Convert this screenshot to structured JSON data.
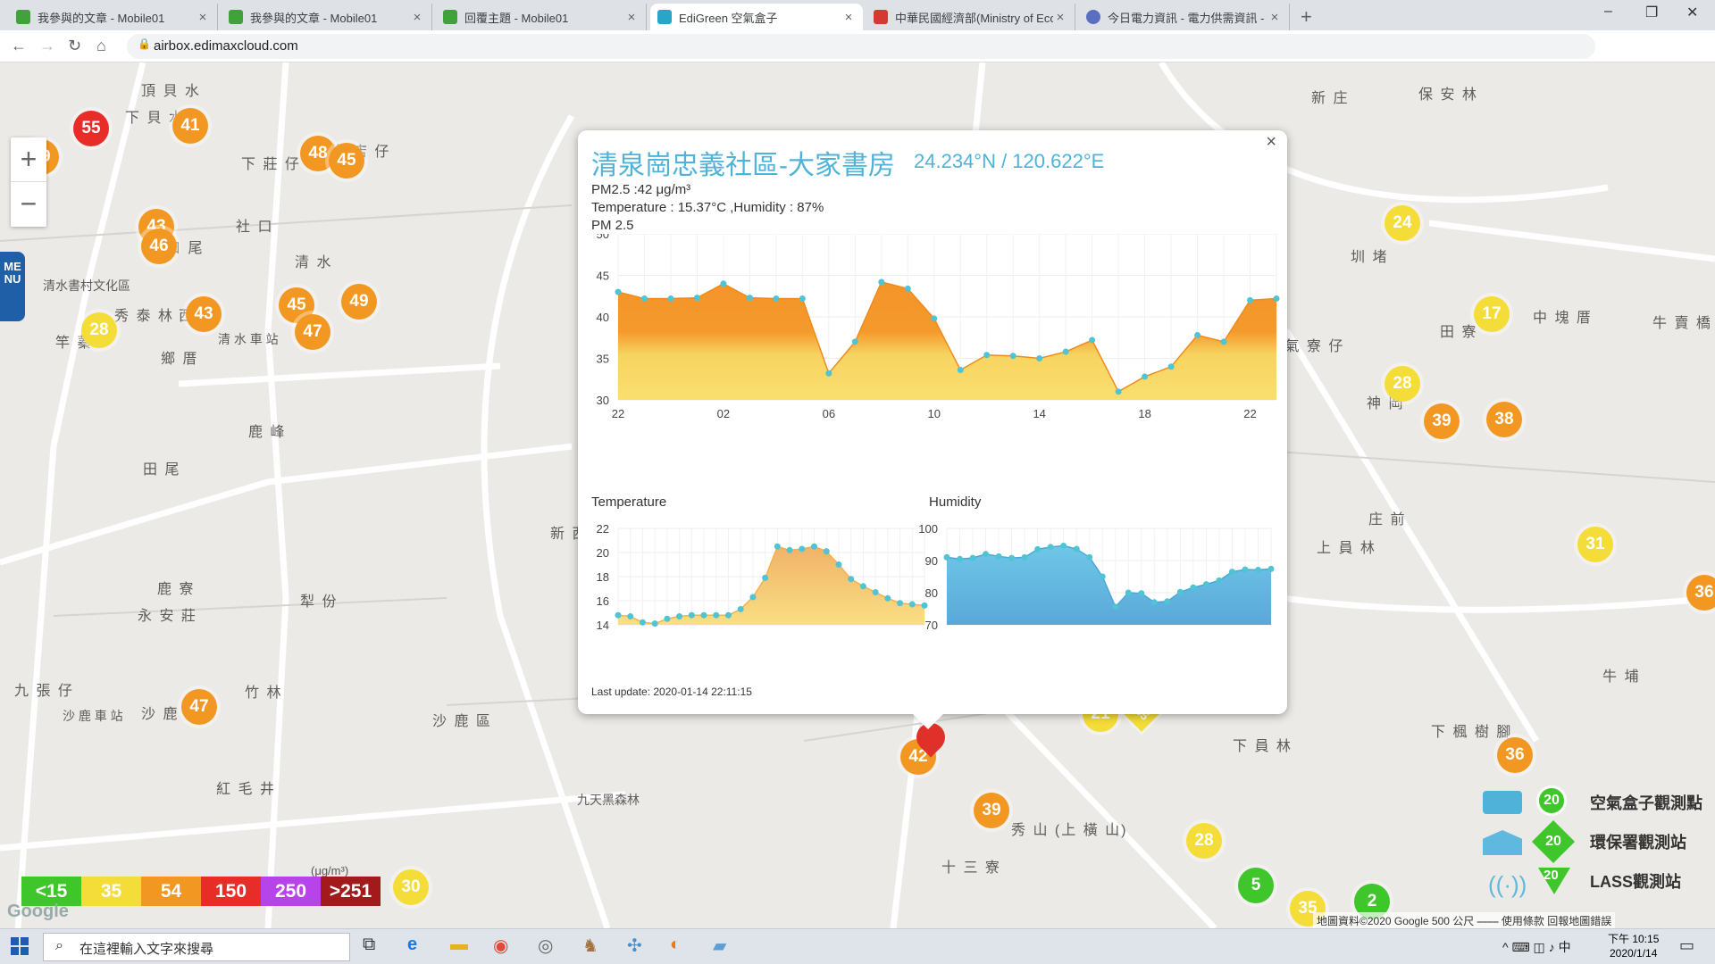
{
  "browser": {
    "tabs": [
      {
        "title": "我參與的文章 - Mobile01",
        "color": "#3fa33a",
        "active": false
      },
      {
        "title": "我參與的文章 - Mobile01",
        "color": "#3fa33a",
        "active": false
      },
      {
        "title": "回覆主題 - Mobile01",
        "color": "#3fa33a",
        "active": false
      },
      {
        "title": "EdiGreen 空氣盒子",
        "color": "#2aa5c9",
        "active": true
      },
      {
        "title": "中華民國經濟部(Ministry of Eco",
        "color": "#d43a2f",
        "active": false
      },
      {
        "title": "今日電力資訊 - 電力供需資訊 - ...",
        "color": "#5a6fbf",
        "active": false
      }
    ],
    "url": "airbox.edimaxcloud.com",
    "new_tab": "+",
    "close_glyph": "×",
    "minimize": "–",
    "maximize": "❐",
    "close_window": "✕"
  },
  "map": {
    "zoom_in": "+",
    "zoom_out": "−",
    "menu_label": "MENU",
    "places": [
      "頂 貝 水",
      "下 貝 水",
      "新 街 店 仔",
      "下 莊 仔",
      "社 口",
      "清 水",
      "口 尾",
      "清水書村文化區",
      "秀 泰 林",
      "竿 蓁",
      "鄉 厝",
      "西 勢",
      "清 水 車 站",
      "鹿 峰",
      "田 尾",
      "鹿 寮",
      "永 安 莊",
      "犁 份",
      "九 張 仔",
      "沙 鹿 車 站",
      "沙 鹿",
      "竹 林",
      "紅 毛 井",
      "沙 鹿 區",
      "新 庄",
      "保 安 林",
      "圳 堵",
      "田 寮",
      "中 塊 厝",
      "牛 賣 橋",
      "電 氣 寮 仔",
      "神 岡",
      "庄 前",
      "上 員 林",
      "牛 埔",
      "下 員 林",
      "下 楓 樹 腳",
      "秀 山 (上 橫 山)",
      "十 三 寮",
      "九天黑森林",
      "新 西"
    ],
    "markers": [
      "55",
      "41",
      "48",
      "45",
      "49",
      "43",
      "46",
      "45",
      "47",
      "43",
      "49",
      "28",
      "47",
      "24",
      "17",
      "28",
      "39",
      "38",
      "31",
      "36",
      "36",
      "39",
      "28",
      "5",
      "35",
      "2",
      "30",
      "21",
      "35",
      "42"
    ]
  },
  "popup": {
    "title": "清泉崗忠義社區-大家書房",
    "coords": "24.234°N / 120.622°E",
    "close": "×",
    "pm_line": "PM2.5 :42 μg/m³",
    "temp_line": "Temperature : 15.37°C ,Humidity : 87%",
    "chart_label": "PM 2.5",
    "last_update": "Last update: 2020-01-14 22:11:15"
  },
  "chart_data": [
    {
      "type": "area",
      "title": "PM 2.5",
      "x": [
        "22",
        "",
        "",
        "",
        "02",
        "",
        "",
        "",
        "06",
        "",
        "",
        "",
        "10",
        "",
        "",
        "",
        "14",
        "",
        "",
        "",
        "18",
        "",
        "",
        "",
        "22"
      ],
      "xticks": [
        "22",
        "02",
        "06",
        "10",
        "14",
        "18",
        "22"
      ],
      "yticks": [
        "30",
        "35",
        "40",
        "45",
        "50"
      ],
      "ylim": [
        30,
        50
      ],
      "values": [
        43,
        42.2,
        42.2,
        42.3,
        44,
        42.3,
        42.2,
        42.2,
        33.2,
        37,
        44.2,
        43.4,
        39.8,
        33.6,
        35.4,
        35.3,
        35,
        35.8,
        37.2,
        31,
        32.8,
        34,
        37.8,
        37,
        42,
        42.2
      ]
    },
    {
      "type": "area",
      "title": "Temperature",
      "yticks": [
        "14",
        "16",
        "18",
        "20",
        "22"
      ],
      "ylim": [
        14,
        22
      ],
      "values": [
        14.8,
        14.7,
        14.2,
        14.1,
        14.5,
        14.7,
        14.8,
        14.8,
        14.8,
        14.8,
        15.3,
        16.3,
        17.9,
        20.5,
        20.2,
        20.3,
        20.5,
        20.1,
        19,
        17.8,
        17.2,
        16.7,
        16.2,
        15.8,
        15.7,
        15.6
      ]
    },
    {
      "type": "area",
      "title": "Humidity",
      "yticks": [
        "70",
        "80",
        "90",
        "100"
      ],
      "ylim": [
        70,
        100
      ],
      "values": [
        91,
        90.5,
        90.8,
        92,
        91.3,
        90.8,
        91,
        93.5,
        94.2,
        94.6,
        93.6,
        91,
        85,
        75.6,
        80,
        79.8,
        77,
        77.3,
        80.2,
        81.6,
        82.6,
        83.8,
        86.5,
        87.2,
        87.1,
        87.4
      ]
    }
  ],
  "legend": {
    "unit": "(μg/m³)",
    "items": [
      {
        "label": "<15",
        "color": "#3ec62b"
      },
      {
        "label": "35",
        "color": "#f4dd38"
      },
      {
        "label": "54",
        "color": "#f29722"
      },
      {
        "label": "150",
        "color": "#e82c28"
      },
      {
        "label": "250",
        "color": "#b744e8"
      },
      {
        "label": ">251",
        "color": "#a31a1c"
      }
    ]
  },
  "station_legend": [
    {
      "label": "空氣盒子觀測點",
      "value": "20"
    },
    {
      "label": "環保署觀測站",
      "value": "20"
    },
    {
      "label": "LASS觀測站",
      "value": "20"
    }
  ],
  "map_footer": "地圖資料©2020 Google   500 公尺  ⎯⎯⎯⎯   使用條款   回報地圖錯誤",
  "google": "Google",
  "taskbar": {
    "search_placeholder": "在這裡輸入文字來搜尋",
    "time": "下午 10:15",
    "date": "2020/1/14",
    "tray": "^  ⌨  ◫  ♪  中"
  }
}
